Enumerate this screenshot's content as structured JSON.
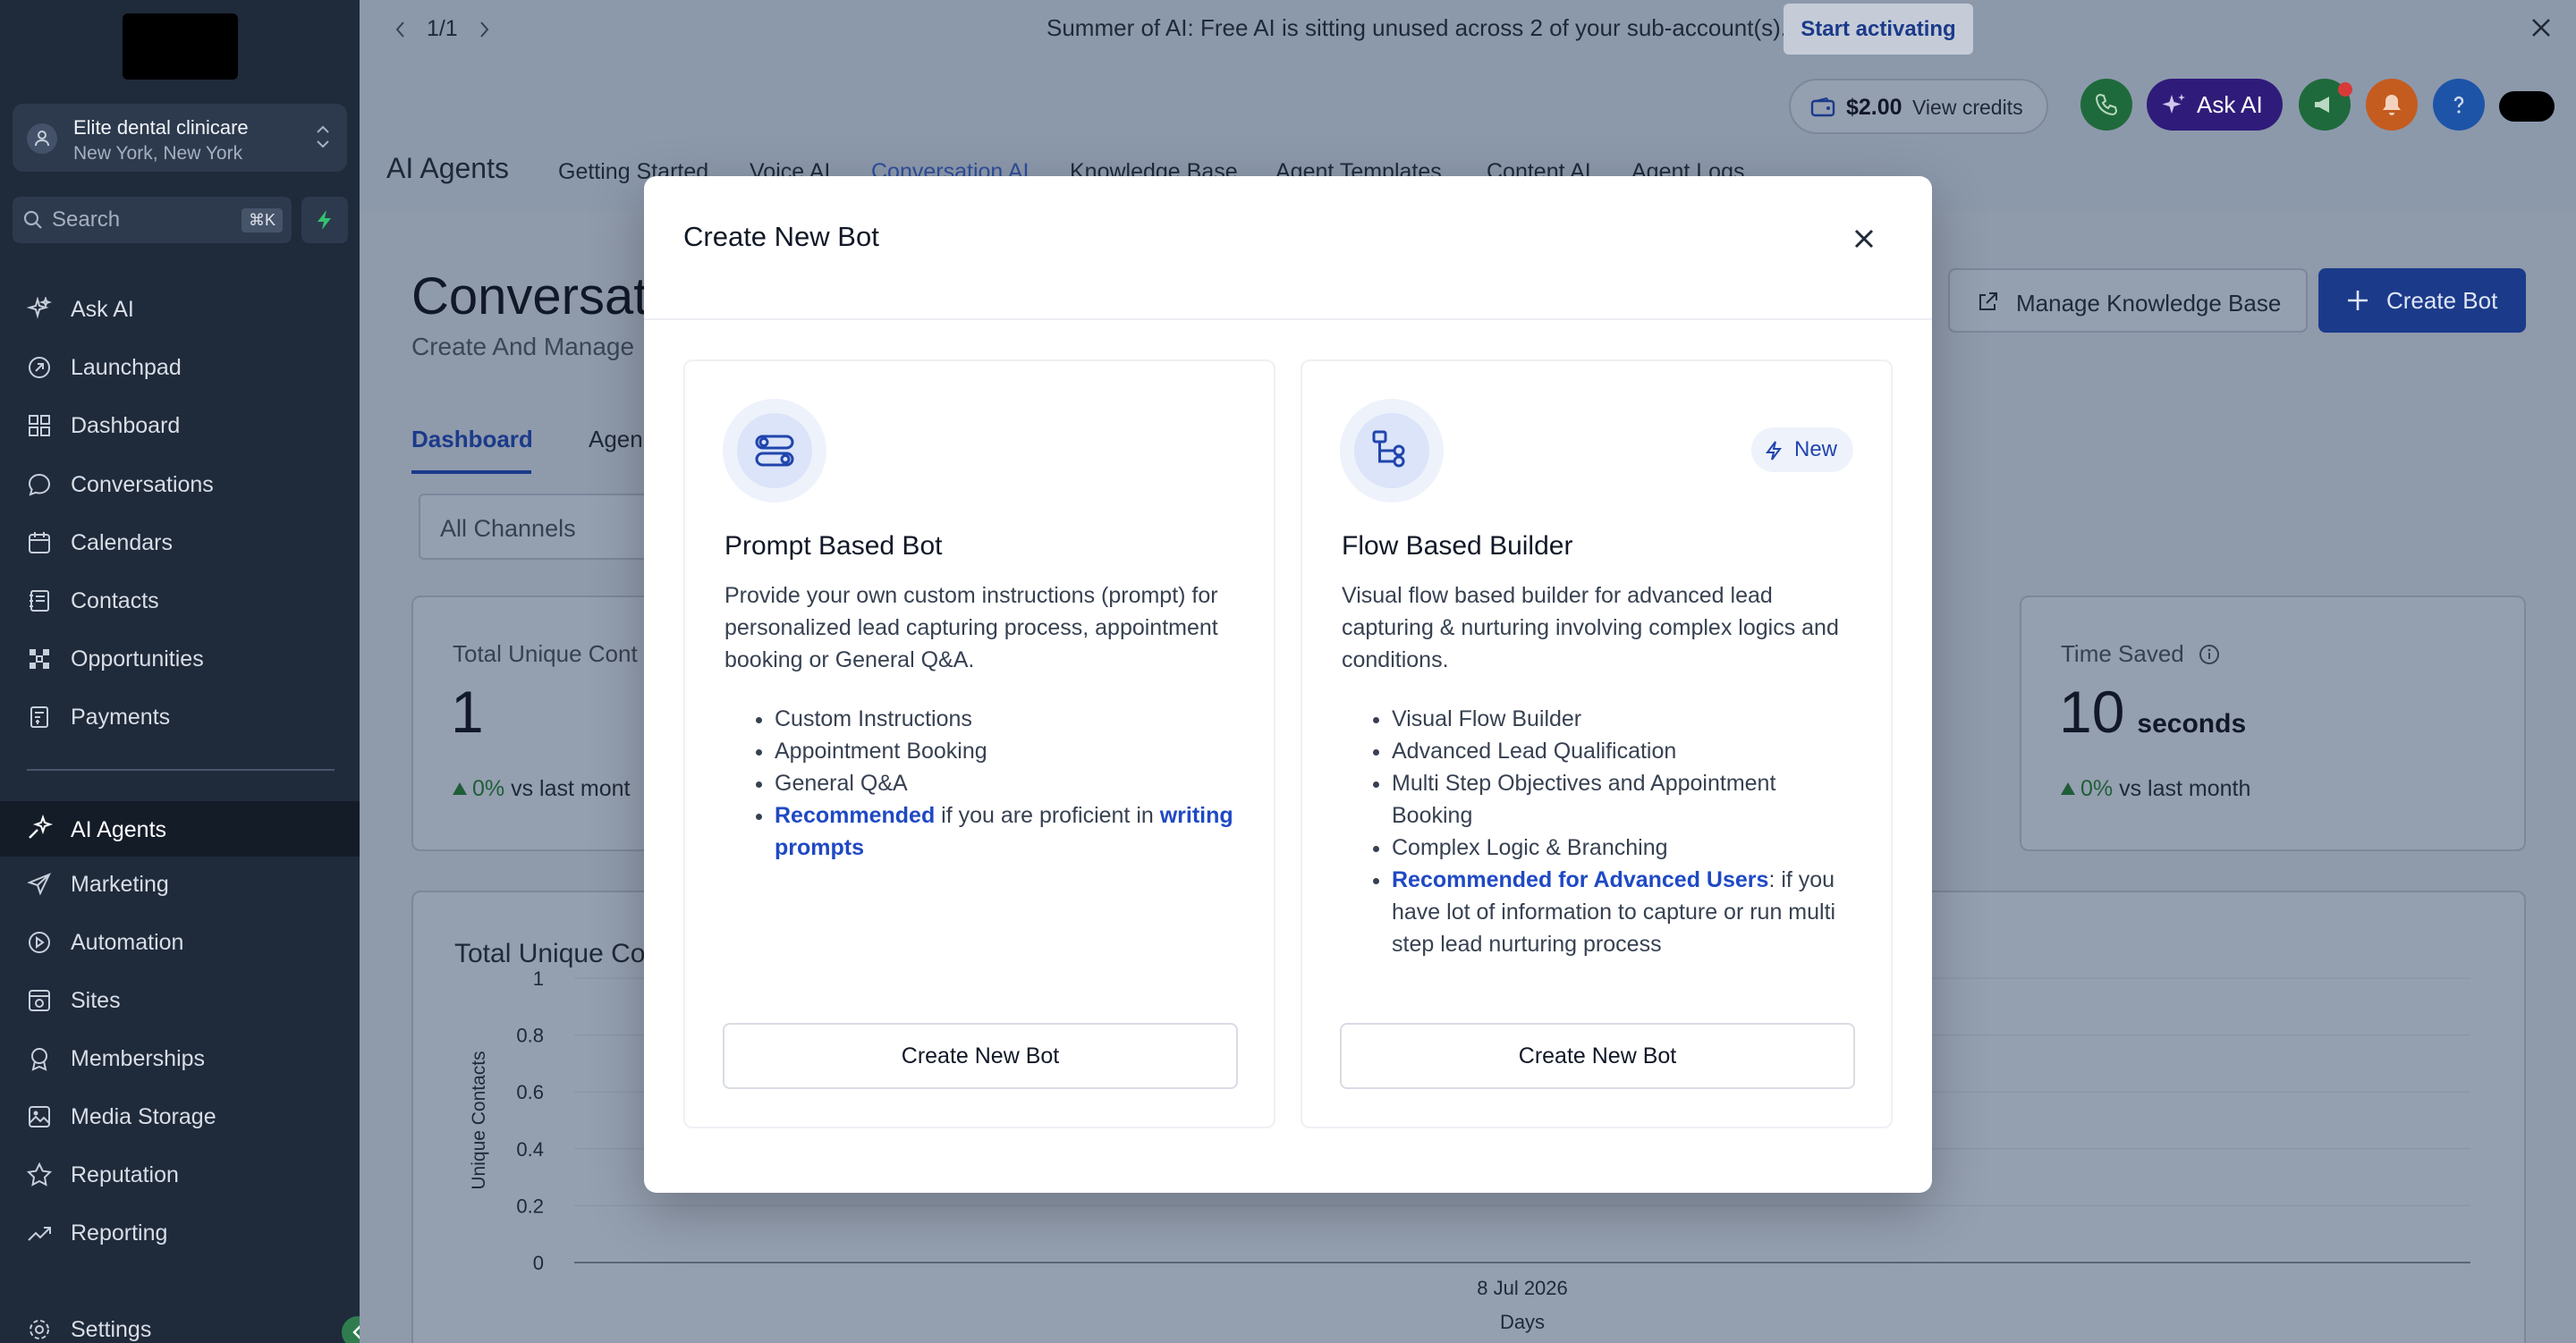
{
  "sidebar": {
    "account": {
      "name": "Elite dental clinicare",
      "location": "New York, New York"
    },
    "search": {
      "placeholder": "Search",
      "shortcut": "⌘K"
    },
    "items": [
      {
        "label": "Ask AI",
        "icon": "sparkle-icon"
      },
      {
        "label": "Launchpad",
        "icon": "rocket-icon"
      },
      {
        "label": "Dashboard",
        "icon": "grid-icon"
      },
      {
        "label": "Conversations",
        "icon": "chat-icon"
      },
      {
        "label": "Calendars",
        "icon": "calendar-icon"
      },
      {
        "label": "Contacts",
        "icon": "contacts-icon"
      },
      {
        "label": "Opportunities",
        "icon": "pipeline-icon"
      },
      {
        "label": "Payments",
        "icon": "receipt-icon"
      },
      {
        "label": "AI Agents",
        "icon": "ai-agents-icon",
        "active": true
      },
      {
        "label": "Marketing",
        "icon": "send-icon"
      },
      {
        "label": "Automation",
        "icon": "automation-icon"
      },
      {
        "label": "Sites",
        "icon": "sites-icon"
      },
      {
        "label": "Memberships",
        "icon": "badge-icon"
      },
      {
        "label": "Media Storage",
        "icon": "image-icon"
      },
      {
        "label": "Reputation",
        "icon": "star-icon"
      },
      {
        "label": "Reporting",
        "icon": "trend-icon"
      },
      {
        "label": "Settings",
        "icon": "gear-icon"
      }
    ]
  },
  "banner": {
    "pager": "1/1",
    "message": "Summer of AI: Free AI is sitting unused across 2 of your sub-account(s).",
    "action": "Start activating"
  },
  "header": {
    "credits_amount": "$2.00",
    "credits_label": "View credits",
    "ask_ai": "Ask AI",
    "title": "AI Agents",
    "tabs": [
      "Getting Started",
      "Voice AI",
      "Conversation AI",
      "Knowledge Base",
      "Agent Templates",
      "Content AI",
      "Agent Logs"
    ]
  },
  "main": {
    "title": "Conversat",
    "subtitle": "Create And Manage",
    "tabs": [
      "Dashboard",
      "Agen"
    ],
    "manage_kb": "Manage Knowledge Base",
    "create_bot": "Create Bot",
    "channel_filter": "All Channels",
    "card_left": {
      "label": "Total Unique Cont",
      "value": "1",
      "delta": "0%",
      "delta_suffix": "vs last mont"
    },
    "card_right": {
      "label": "Time Saved",
      "value": "10",
      "unit": "seconds",
      "delta": "0%",
      "delta_suffix": "vs last month"
    },
    "chart_title": "Total Unique Co"
  },
  "chart_data": {
    "type": "line",
    "title": "Total Unique Co",
    "xlabel": "Days",
    "ylabel": "Unique Contacts",
    "x": [
      "8 Jul 2026"
    ],
    "y_ticks": [
      "1",
      "0.8",
      "0.6",
      "0.4",
      "0.2",
      "0"
    ],
    "ylim": [
      0,
      1
    ],
    "grid": true
  },
  "modal": {
    "title": "Create New Bot",
    "options": [
      {
        "title": "Prompt Based Bot",
        "description": "Provide your own custom instructions (prompt) for personalized lead capturing process, appointment booking or General Q&A.",
        "bullets": [
          "Custom Instructions",
          "Appointment Booking",
          "General Q&A"
        ],
        "rec_link": "Recommended",
        "rec_text": " if you are proficient in ",
        "rec_link2": "writing prompts",
        "button": "Create New Bot"
      },
      {
        "title": "Flow Based Builder",
        "badge": "New",
        "description": "Visual flow based builder for advanced lead capturing & nurturing involving complex logics and conditions.",
        "bullets": [
          "Visual Flow Builder",
          "Advanced Lead Qualification",
          "Multi Step Objectives and Appointment Booking",
          "Complex Logic & Branching"
        ],
        "rec_link": "Recommended for Advanced Users",
        "rec_text": ": if you have lot of information to capture or run multi step lead nurturing process",
        "button": "Create New Bot"
      }
    ]
  },
  "colors": {
    "sidebar_bg": "#1f2a3b",
    "primary": "#1f49c4",
    "success": "#2e8b57",
    "ask_ai_bg": "#3b1f9e"
  }
}
